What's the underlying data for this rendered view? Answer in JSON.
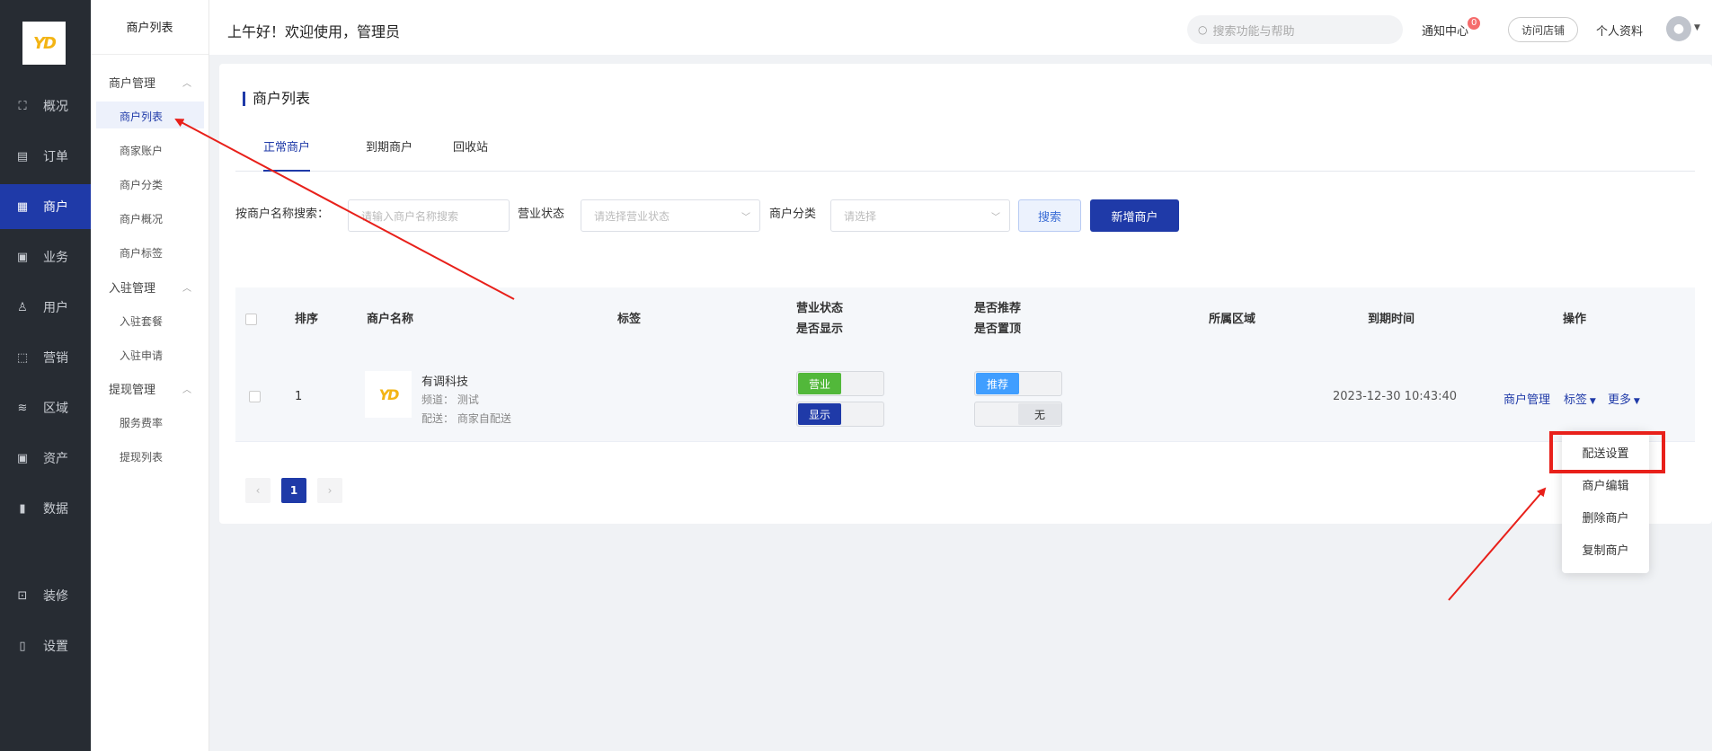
{
  "logo_text": "YD",
  "nav": [
    {
      "icon": "dashboard-icon",
      "glyph": "⛶",
      "label": "概况"
    },
    {
      "icon": "order-icon",
      "glyph": "▤",
      "label": "订单"
    },
    {
      "icon": "merchant-icon",
      "glyph": "▦",
      "label": "商户"
    },
    {
      "icon": "business-icon",
      "glyph": "▣",
      "label": "业务"
    },
    {
      "icon": "user-icon",
      "glyph": "♙",
      "label": "用户"
    },
    {
      "icon": "marketing-icon",
      "glyph": "⬚",
      "label": "营销"
    },
    {
      "icon": "region-icon",
      "glyph": "≋",
      "label": "区域"
    },
    {
      "icon": "asset-icon",
      "glyph": "▣",
      "label": "资产"
    },
    {
      "icon": "data-icon",
      "glyph": "▮",
      "label": "数据"
    },
    {
      "icon": "decorate-icon",
      "glyph": "⊡",
      "label": "装修"
    },
    {
      "icon": "settings-icon",
      "glyph": "▯",
      "label": "设置"
    }
  ],
  "subnav": {
    "title": "商户列表",
    "groups": [
      {
        "label": "商户管理",
        "items": [
          "商户列表",
          "商家账户",
          "商户分类",
          "商户概况",
          "商户标签"
        ]
      },
      {
        "label": "入驻管理",
        "items": [
          "入驻套餐",
          "入驻申请"
        ]
      },
      {
        "label": "提现管理",
        "items": [
          "服务费率",
          "提现列表"
        ]
      }
    ]
  },
  "header": {
    "greeting": "上午好！欢迎使用，管理员",
    "search_placeholder": "搜索功能与帮助",
    "notice": "通知中心",
    "notice_count": "0",
    "visit_store": "访问店铺",
    "profile": "个人资料"
  },
  "page": {
    "title": "商户列表",
    "tabs": [
      "正常商户",
      "到期商户",
      "回收站"
    ],
    "filters": {
      "name_label": "按商户名称搜索：",
      "name_placeholder": "请输入商户名称搜索",
      "status_label": "营业状态",
      "status_placeholder": "请选择营业状态",
      "category_label": "商户分类",
      "category_placeholder": "请选择",
      "search_button": "搜索",
      "add_button": "新增商户"
    },
    "columns": {
      "sort": "排序",
      "name": "商户名称",
      "tag": "标签",
      "status1": "营业状态",
      "status2": "是否显示",
      "rec1": "是否推荐",
      "rec2": "是否置顶",
      "region": "所属区域",
      "expire": "到期时间",
      "ops": "操作"
    },
    "row": {
      "sort": "1",
      "name": "有调科技",
      "channel": "频道： 测试",
      "delivery": "配送： 商家自配送",
      "open_label": "营业",
      "show_label": "显示",
      "recommend_label": "推荐",
      "top_label": "无",
      "expire": "2023-12-30 10:43:40",
      "op_manage": "商户管理",
      "op_tag": "标签",
      "op_more": "更多"
    },
    "pagination": {
      "prev": "‹",
      "current": "1",
      "next": "›"
    },
    "more_menu": [
      "配送设置",
      "商户编辑",
      "删除商户",
      "复制商户"
    ]
  },
  "colors": {
    "primary": "#1f3aa8",
    "green": "#52b83a",
    "blue": "#409eff",
    "annotation": "#e8201a"
  }
}
